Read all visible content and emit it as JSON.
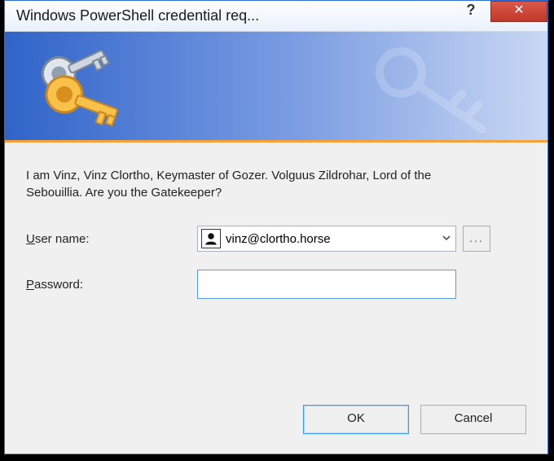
{
  "window": {
    "title": "Windows PowerShell credential req...",
    "help_text": "?",
    "close_text": "✕"
  },
  "banner": {
    "icon_name": "keys-icon"
  },
  "dialog": {
    "message": "I am Vinz, Vinz Clortho, Keymaster of Gozer. Volguus Zildrohar, Lord of the Sebouillia. Are you the Gatekeeper?",
    "username_label_prefix": "U",
    "username_label_rest": "ser name:",
    "password_label_prefix": "P",
    "password_label_rest": "assword:",
    "username_value": "vinz@clortho.horse",
    "password_value": "",
    "browse_label": "...",
    "ok_label": "OK",
    "cancel_label": "Cancel"
  }
}
